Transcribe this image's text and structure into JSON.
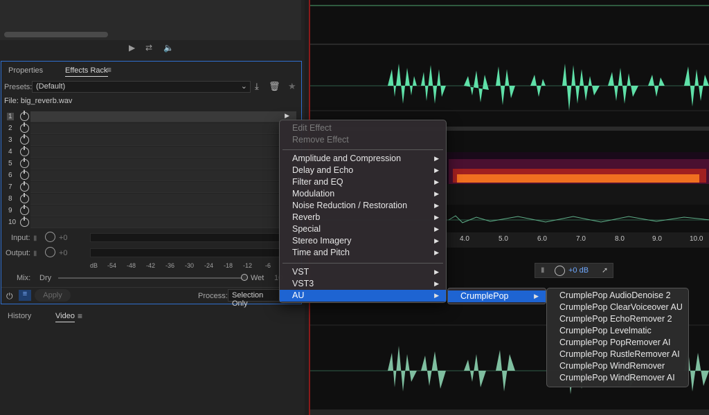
{
  "transport": {
    "play_icon": "play-icon",
    "loop_icon": "loop-icon",
    "skip_icon": "volume-icon"
  },
  "tabs": {
    "properties": "Properties",
    "effects_rack": "Effects Rack"
  },
  "presets": {
    "label": "Presets:",
    "value": "(Default)"
  },
  "file": {
    "label": "File: big_reverb.wav"
  },
  "slots": [
    "1",
    "2",
    "3",
    "4",
    "5",
    "6",
    "7",
    "8",
    "9",
    "10"
  ],
  "io": {
    "input_label": "Input:",
    "input_value": "+0",
    "output_label": "Output:",
    "output_value": "+0"
  },
  "scale": [
    "dB",
    "-54",
    "-48",
    "-42",
    "-36",
    "-30",
    "-24",
    "-18",
    "-12",
    "-6"
  ],
  "mix": {
    "label": "Mix:",
    "dry": "Dry",
    "wet": "Wet",
    "wet_value": "10"
  },
  "footer": {
    "apply": "Apply",
    "process_label": "Process:",
    "process_value": "Selection Only"
  },
  "bottom_tabs": {
    "history": "History",
    "video": "Video"
  },
  "ruler": [
    "4.0",
    "5.0",
    "6.0",
    "7.0",
    "8.0",
    "9.0",
    "10.0"
  ],
  "hud": {
    "volume": "+0 dB"
  },
  "context_menu": {
    "edit_effect": "Edit Effect",
    "remove_effect": "Remove Effect",
    "categories": [
      "Amplitude and Compression",
      "Delay and Echo",
      "Filter and EQ",
      "Modulation",
      "Noise Reduction / Restoration",
      "Reverb",
      "Special",
      "Stereo Imagery",
      "Time and Pitch"
    ],
    "plugins": [
      "VST",
      "VST3",
      "AU"
    ]
  },
  "submenu": {
    "vendor": "CrumplePop"
  },
  "plugin_list": [
    "CrumplePop AudioDenoise 2",
    "CrumplePop ClearVoiceover AU",
    "CrumplePop EchoRemover 2",
    "CrumplePop Levelmatic",
    "CrumplePop PopRemover AI",
    "CrumplePop RustleRemover AI",
    "CrumplePop WindRemover",
    "CrumplePop WindRemover AI"
  ],
  "colors": {
    "accent": "#1e64d2",
    "wave": "#5fe0a8",
    "wave_dim": "#7fbfa0",
    "rack_border": "#2f6fd0"
  }
}
